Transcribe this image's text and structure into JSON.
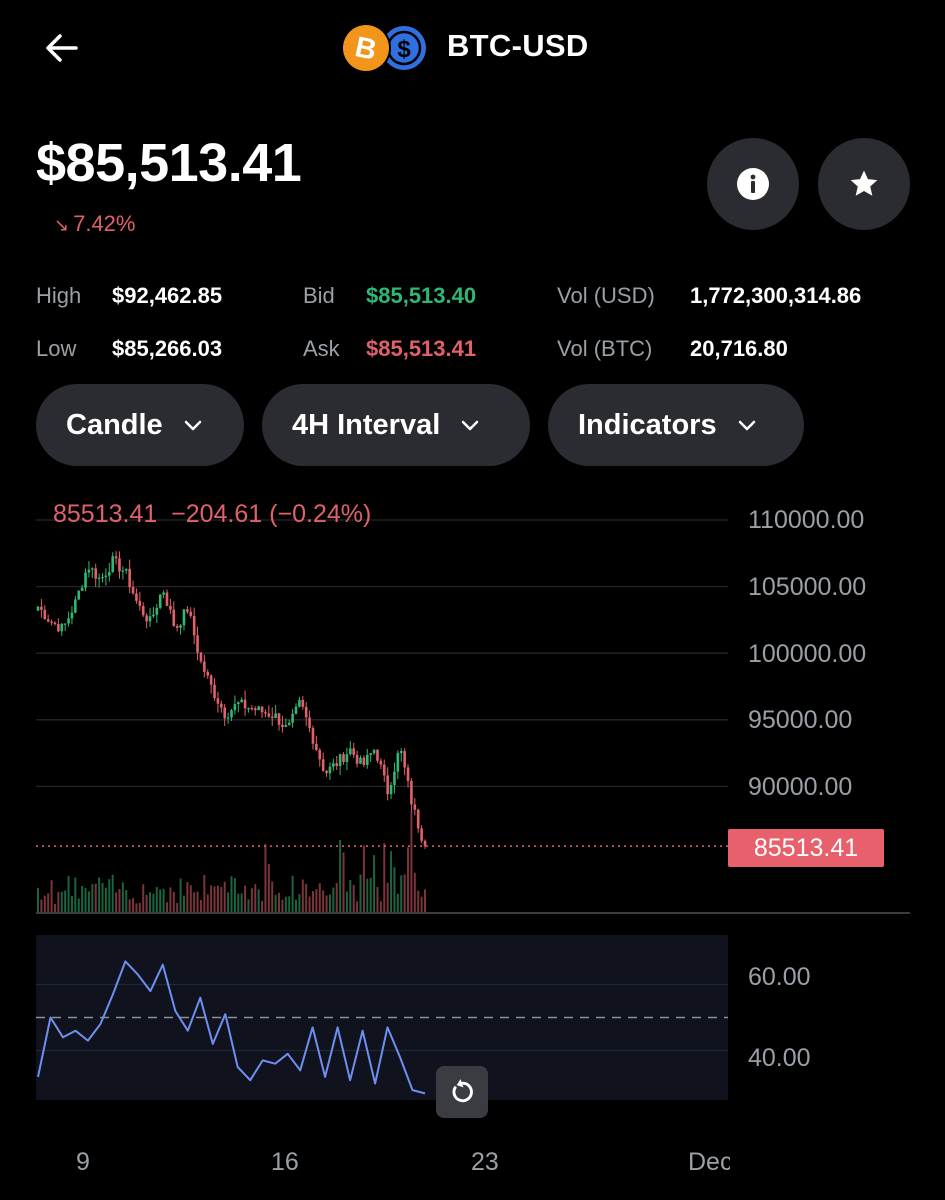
{
  "header": {
    "back_icon": "arrow-left-icon",
    "pair_icons": [
      "bitcoin-icon",
      "usd-coin-icon"
    ],
    "title": "BTC-USD"
  },
  "price": {
    "current": "$85,513.41",
    "change": "7.42%",
    "change_direction": "down",
    "change_color": "#e0616a"
  },
  "actions": {
    "info_icon": "info-icon",
    "star_icon": "star-icon"
  },
  "stats": {
    "high_label": "High",
    "high_value": "$92,462.85",
    "low_label": "Low",
    "low_value": "$85,266.03",
    "bid_label": "Bid",
    "bid_value": "$85,513.40",
    "ask_label": "Ask",
    "ask_value": "$85,513.41",
    "vol_usd_label": "Vol (USD)",
    "vol_usd_value": "1,772,300,314.86",
    "vol_btc_label": "Vol (BTC)",
    "vol_btc_value": "20,716.80"
  },
  "controls": {
    "chart_type": "Candle",
    "interval": "4H Interval",
    "indicators": "Indicators"
  },
  "chart": {
    "ohlc_line": "85513.41  −204.61 (−0.24%)",
    "current_tag": "85513.41",
    "y_labels": [
      "110000.00",
      "105000.00",
      "100000.00",
      "95000.00",
      "90000.00"
    ],
    "rsi_labels": [
      "60.00",
      "40.00"
    ],
    "x_labels": [
      "9",
      "16",
      "23",
      "Dec"
    ],
    "colors": {
      "up": "#2fb774",
      "down": "#e0616a",
      "rsi": "#6f8ff0"
    }
  },
  "chart_data": {
    "type": "candlestick",
    "interval": "4H",
    "x_labels": [
      "9",
      "16",
      "23",
      "Dec"
    ],
    "ylim": [
      85000,
      110000
    ],
    "y_ticks": [
      90000,
      95000,
      100000,
      105000,
      110000
    ],
    "last_price": 85513.41,
    "close_path": [
      103500,
      102400,
      101800,
      103800,
      106600,
      105500,
      106900,
      106100,
      103600,
      102300,
      104900,
      101800,
      103400,
      99400,
      97200,
      95400,
      96200,
      95900,
      95600,
      95300,
      94200,
      96300,
      93700,
      91000,
      91800,
      92800,
      91500,
      92900,
      89600,
      92900,
      88500,
      85513.41
    ],
    "rsi": {
      "ylim": [
        25,
        75
      ],
      "ticks": [
        40,
        60
      ],
      "midline": 50,
      "values": [
        32,
        50,
        44,
        46,
        43,
        48,
        57,
        67,
        63,
        58,
        66,
        52,
        46,
        56,
        42,
        51,
        35,
        31,
        37,
        36,
        39,
        34,
        47,
        32,
        47,
        31,
        46,
        30,
        47,
        38,
        28,
        27
      ]
    }
  }
}
